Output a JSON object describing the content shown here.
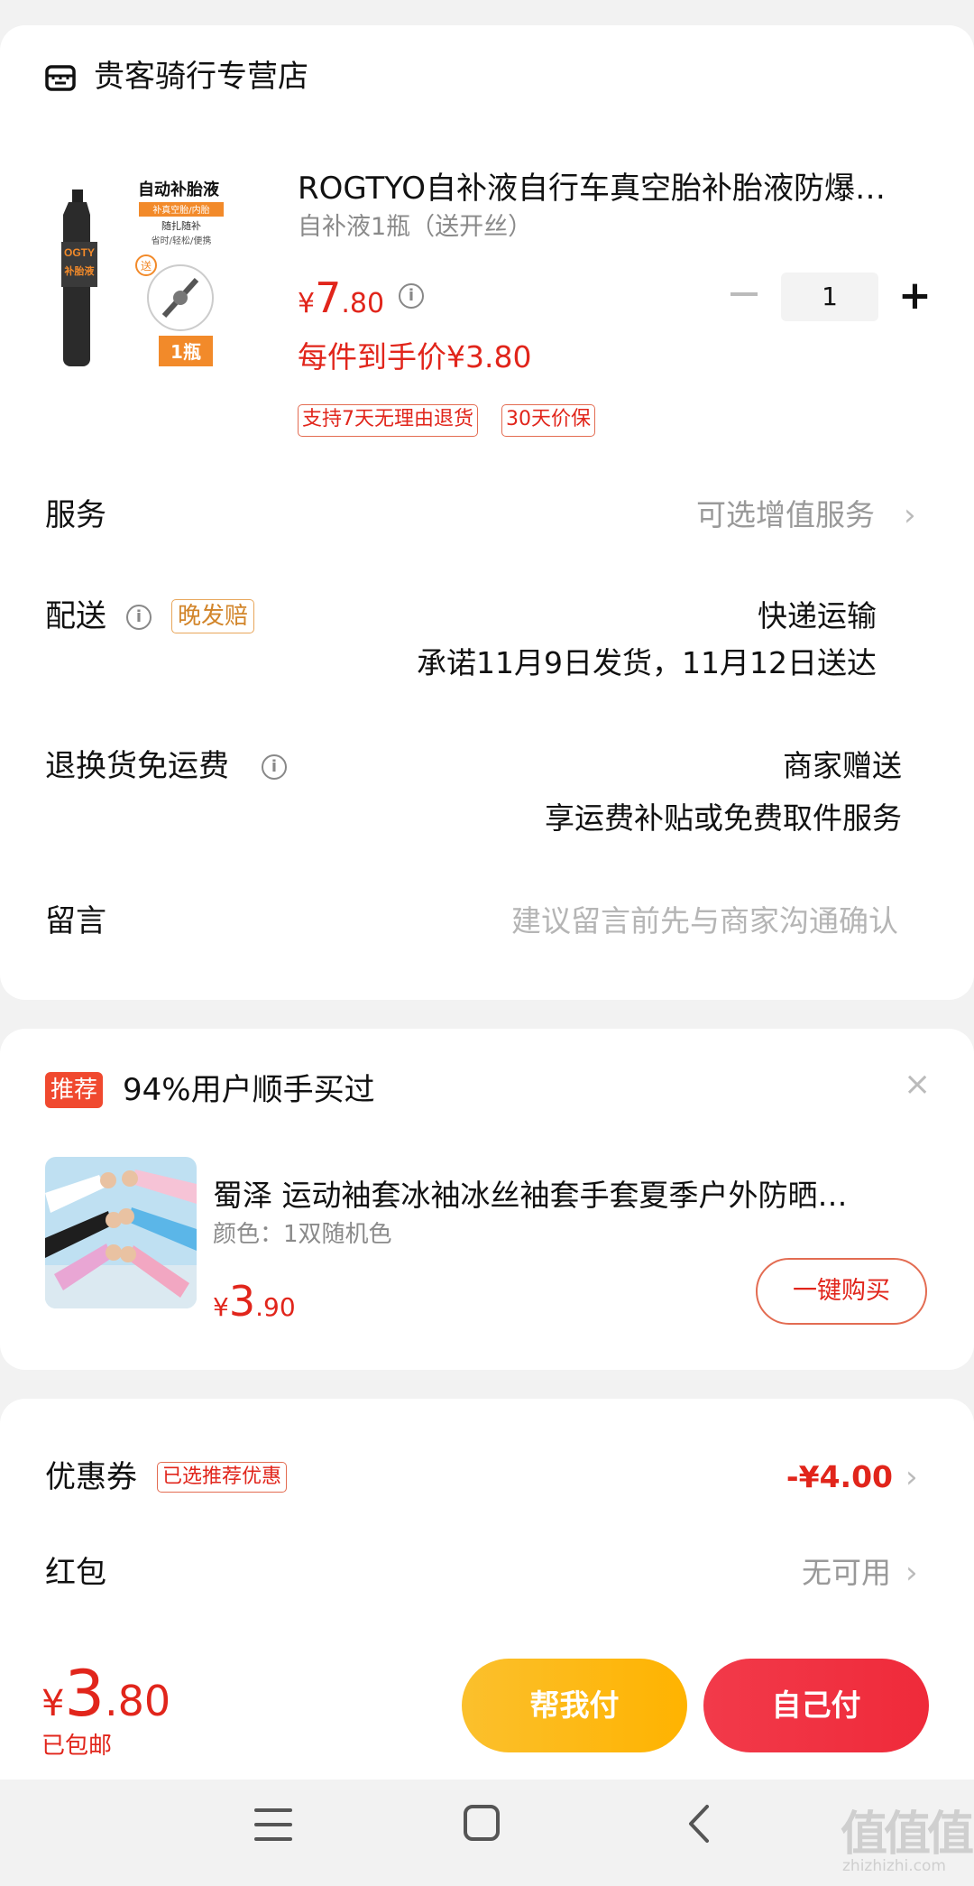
{
  "shop": {
    "icon": "store-icon",
    "name": "贵客骑行专营店"
  },
  "product": {
    "thumb_lines": [
      "自动补胎液",
      "补真空胎/内胎",
      "随扎随补",
      "省时/轻松/便携",
      "OGTY",
      "补胎液",
      "送",
      "1瓶"
    ],
    "title": "ROGTYO自补液自行车真空胎补胎液防爆…",
    "sku": "自补液1瓶（送开丝）",
    "price": {
      "currency": "¥",
      "int": "7",
      "dec": ".80"
    },
    "per_item_price": "每件到手价¥3.80",
    "tags": [
      "支持7天无理由退货",
      "30天价保"
    ],
    "quantity": "1"
  },
  "rows": {
    "service": {
      "label": "服务",
      "value": "可选增值服务"
    },
    "delivery": {
      "label": "配送",
      "badge": "晚发赔",
      "method": "快递运输",
      "promise": "承诺11月9日发货，11月12日送达"
    },
    "return": {
      "label": "退换货免运费",
      "value1": "商家赠送",
      "value2": "享运费补贴或免费取件服务"
    },
    "message": {
      "label": "留言",
      "placeholder": "建议留言前先与商家沟通确认"
    }
  },
  "recommend": {
    "tag": "推荐",
    "title": "94%用户顺手买过",
    "close": "×",
    "name": "蜀泽 运动袖套冰袖冰丝袖套手套夏季户外防晒…",
    "sku": "颜色：1双随机色",
    "price": {
      "currency": "¥",
      "int": "3",
      "dec": ".90"
    },
    "buy_label": "一键购买"
  },
  "discounts": {
    "coupon": {
      "label": "优惠券",
      "tag": "已选推荐优惠",
      "value": "-¥4.00"
    },
    "redpacket": {
      "label": "红包",
      "value": "无可用"
    }
  },
  "footer": {
    "total": {
      "currency": "¥",
      "int": "3",
      "dec": ".80"
    },
    "shipping": "已包邮",
    "help_pay": "帮我付",
    "self_pay": "自己付"
  },
  "watermark": {
    "text": "值值值",
    "url": "zhizhizhi.com"
  },
  "colors": {
    "accent_red": "#e1251b",
    "pay_red": "#ef2a3a",
    "help_yellow": "#fbc02d"
  }
}
